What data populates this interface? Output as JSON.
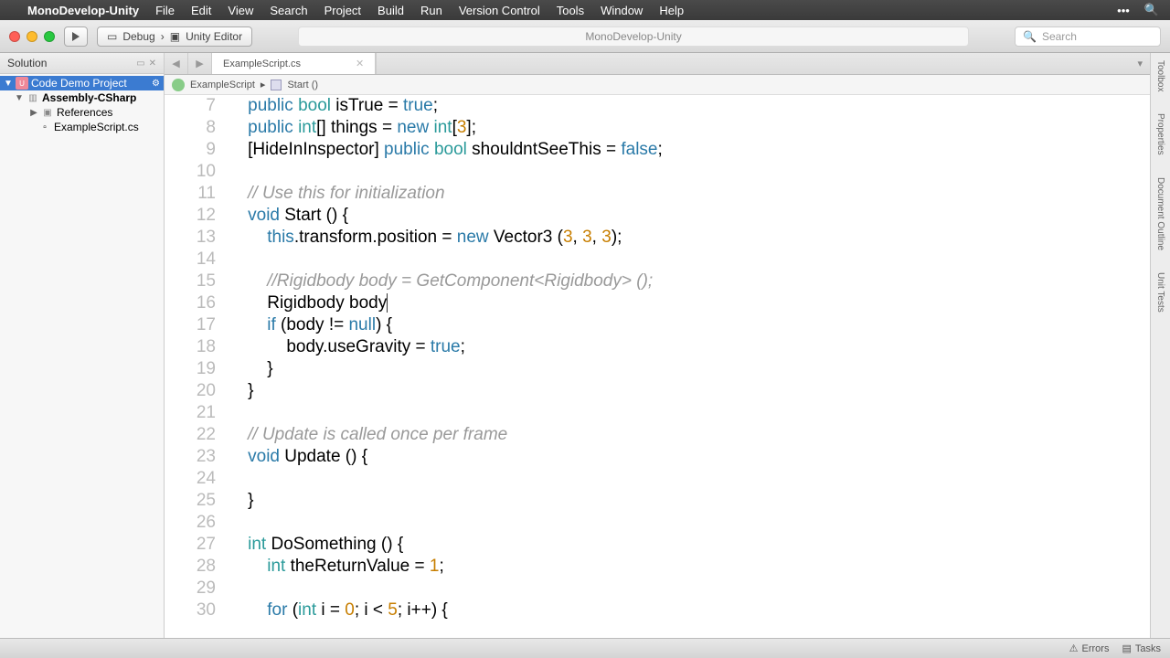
{
  "menubar": {
    "app": "MonoDevelop-Unity",
    "items": [
      "File",
      "Edit",
      "View",
      "Search",
      "Project",
      "Build",
      "Run",
      "Version Control",
      "Tools",
      "Window",
      "Help"
    ]
  },
  "toolbar": {
    "config": "Debug",
    "target": "Unity Editor",
    "center_title": "MonoDevelop-Unity",
    "search_placeholder": "Search"
  },
  "sidebar": {
    "title": "Solution",
    "project": "Code Demo Project",
    "assembly": "Assembly-CSharp",
    "references": "References",
    "file": "ExampleScript.cs"
  },
  "tab": {
    "name": "ExampleScript.cs"
  },
  "breadcrumb": {
    "class": "ExampleScript",
    "method": "Start ()"
  },
  "right_panels": [
    "Toolbox",
    "Properties",
    "Document Outline",
    "Unit Tests"
  ],
  "status": {
    "errors": "Errors",
    "tasks": "Tasks"
  },
  "code": {
    "first_line": 7,
    "lines": [
      {
        "n": 7,
        "tokens": [
          [
            "    ",
            ""
          ],
          [
            "public",
            "kw"
          ],
          [
            " ",
            ""
          ],
          [
            "bool",
            "typ"
          ],
          [
            " isTrue = ",
            ""
          ],
          [
            "true",
            "kw"
          ],
          [
            ";",
            ""
          ]
        ]
      },
      {
        "n": 8,
        "tokens": [
          [
            "    ",
            ""
          ],
          [
            "public",
            "kw"
          ],
          [
            " ",
            ""
          ],
          [
            "int",
            "typ"
          ],
          [
            "[] things = ",
            ""
          ],
          [
            "new",
            "kw"
          ],
          [
            " ",
            ""
          ],
          [
            "int",
            "typ"
          ],
          [
            "[",
            ""
          ],
          [
            "3",
            "num"
          ],
          [
            "];",
            ""
          ]
        ]
      },
      {
        "n": 9,
        "tokens": [
          [
            "    [HideInInspector] ",
            ""
          ],
          [
            "public",
            "kw"
          ],
          [
            " ",
            ""
          ],
          [
            "bool",
            "typ"
          ],
          [
            " shouldntSeeThis = ",
            ""
          ],
          [
            "false",
            "kw"
          ],
          [
            ";",
            ""
          ]
        ]
      },
      {
        "n": 10,
        "tokens": [
          [
            "",
            ""
          ]
        ]
      },
      {
        "n": 11,
        "tokens": [
          [
            "    ",
            ""
          ],
          [
            "// Use this for initialization",
            "cm"
          ]
        ]
      },
      {
        "n": 12,
        "tokens": [
          [
            "    ",
            ""
          ],
          [
            "void",
            "kw"
          ],
          [
            " Start () {",
            ""
          ]
        ]
      },
      {
        "n": 13,
        "tokens": [
          [
            "        ",
            ""
          ],
          [
            "this",
            "kw"
          ],
          [
            ".transform.position = ",
            ""
          ],
          [
            "new",
            "kw"
          ],
          [
            " Vector3 (",
            ""
          ],
          [
            "3",
            "num"
          ],
          [
            ", ",
            ""
          ],
          [
            "3",
            "num"
          ],
          [
            ", ",
            ""
          ],
          [
            "3",
            "num"
          ],
          [
            ");",
            ""
          ]
        ]
      },
      {
        "n": 14,
        "tokens": [
          [
            "",
            ""
          ]
        ]
      },
      {
        "n": 15,
        "tokens": [
          [
            "        ",
            ""
          ],
          [
            "//Rigidbody body = GetComponent<Rigidbody> ();",
            "cm"
          ]
        ]
      },
      {
        "n": 16,
        "tokens": [
          [
            "        Rigidbody body",
            ""
          ]
        ],
        "cursor": true
      },
      {
        "n": 17,
        "tokens": [
          [
            "        ",
            ""
          ],
          [
            "if",
            "kw"
          ],
          [
            " (body != ",
            ""
          ],
          [
            "null",
            "kw"
          ],
          [
            ") {",
            ""
          ]
        ]
      },
      {
        "n": 18,
        "tokens": [
          [
            "            body.useGravity = ",
            ""
          ],
          [
            "true",
            "kw"
          ],
          [
            ";",
            ""
          ]
        ]
      },
      {
        "n": 19,
        "tokens": [
          [
            "        }",
            ""
          ]
        ]
      },
      {
        "n": 20,
        "tokens": [
          [
            "    }",
            ""
          ]
        ]
      },
      {
        "n": 21,
        "tokens": [
          [
            "",
            ""
          ]
        ]
      },
      {
        "n": 22,
        "tokens": [
          [
            "    ",
            ""
          ],
          [
            "// Update is called once per frame",
            "cm"
          ]
        ]
      },
      {
        "n": 23,
        "tokens": [
          [
            "    ",
            ""
          ],
          [
            "void",
            "kw"
          ],
          [
            " Update () {",
            ""
          ]
        ]
      },
      {
        "n": 24,
        "tokens": [
          [
            "",
            ""
          ]
        ]
      },
      {
        "n": 25,
        "tokens": [
          [
            "    }",
            ""
          ]
        ]
      },
      {
        "n": 26,
        "tokens": [
          [
            "",
            ""
          ]
        ]
      },
      {
        "n": 27,
        "tokens": [
          [
            "    ",
            ""
          ],
          [
            "int",
            "typ"
          ],
          [
            " DoSomething () {",
            ""
          ]
        ]
      },
      {
        "n": 28,
        "tokens": [
          [
            "        ",
            ""
          ],
          [
            "int",
            "typ"
          ],
          [
            " theReturnValue = ",
            ""
          ],
          [
            "1",
            "num"
          ],
          [
            ";",
            ""
          ]
        ]
      },
      {
        "n": 29,
        "tokens": [
          [
            "",
            ""
          ]
        ]
      },
      {
        "n": 30,
        "tokens": [
          [
            "        ",
            ""
          ],
          [
            "for",
            "kw"
          ],
          [
            " (",
            ""
          ],
          [
            "int",
            "typ"
          ],
          [
            " i = ",
            ""
          ],
          [
            "0",
            "num"
          ],
          [
            "; i < ",
            ""
          ],
          [
            "5",
            "num"
          ],
          [
            "; i++) {",
            ""
          ]
        ]
      }
    ]
  }
}
